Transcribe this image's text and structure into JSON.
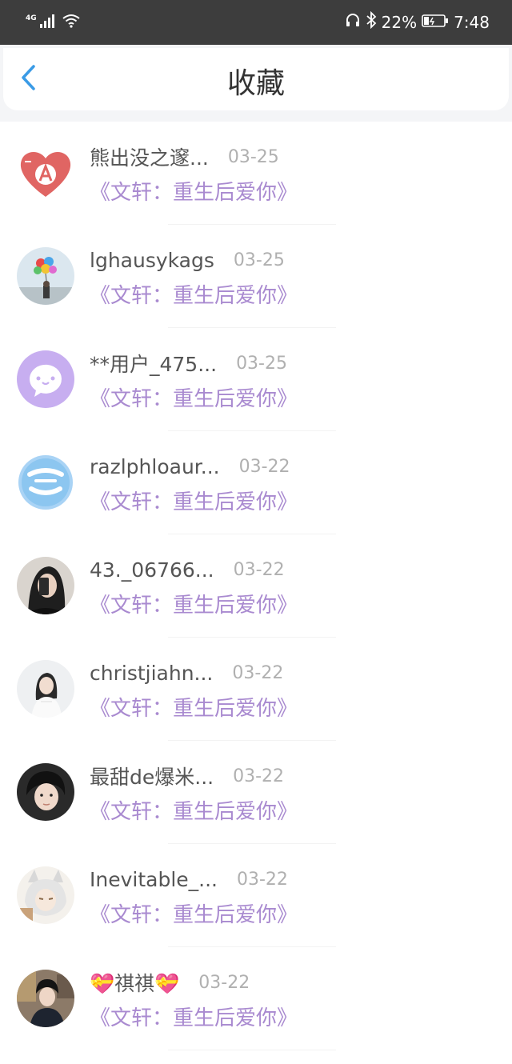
{
  "status_bar": {
    "network": "4G",
    "battery_percent": "22%",
    "time": "7:48"
  },
  "header": {
    "title": "收藏"
  },
  "items": [
    {
      "name": "熊出没之邃...",
      "date": "03-25",
      "book": "《文轩：重生后爱你》",
      "avatar": "heart-a-avatar"
    },
    {
      "name": "lghausykags",
      "date": "03-25",
      "book": "《文轩：重生后爱你》",
      "avatar": "balloons-avatar"
    },
    {
      "name": "**用户_475...",
      "date": "03-25",
      "book": "《文轩：重生后爱你》",
      "avatar": "chat-bubble-avatar"
    },
    {
      "name": "razlphloaur...",
      "date": "03-22",
      "book": "《文轩：重生后爱你》",
      "avatar": "badge-avatar"
    },
    {
      "name": "43._06766...",
      "date": "03-22",
      "book": "《文轩：重生后爱你》",
      "avatar": "selfie-avatar"
    },
    {
      "name": "christjiahn...",
      "date": "03-22",
      "book": "《文轩：重生后爱你》",
      "avatar": "girl-white-avatar"
    },
    {
      "name": "最甜de爆米...",
      "date": "03-22",
      "book": "《文轩：重生后爱你》",
      "avatar": "boy-portrait-avatar"
    },
    {
      "name": "Inevitable_...",
      "date": "03-22",
      "book": "《文轩：重生后爱你》",
      "avatar": "anime-fox-avatar"
    },
    {
      "name": "💝祺祺💝",
      "date": "03-22",
      "book": "《文轩：重生后爱你》",
      "avatar": "boy-street-avatar"
    }
  ]
}
